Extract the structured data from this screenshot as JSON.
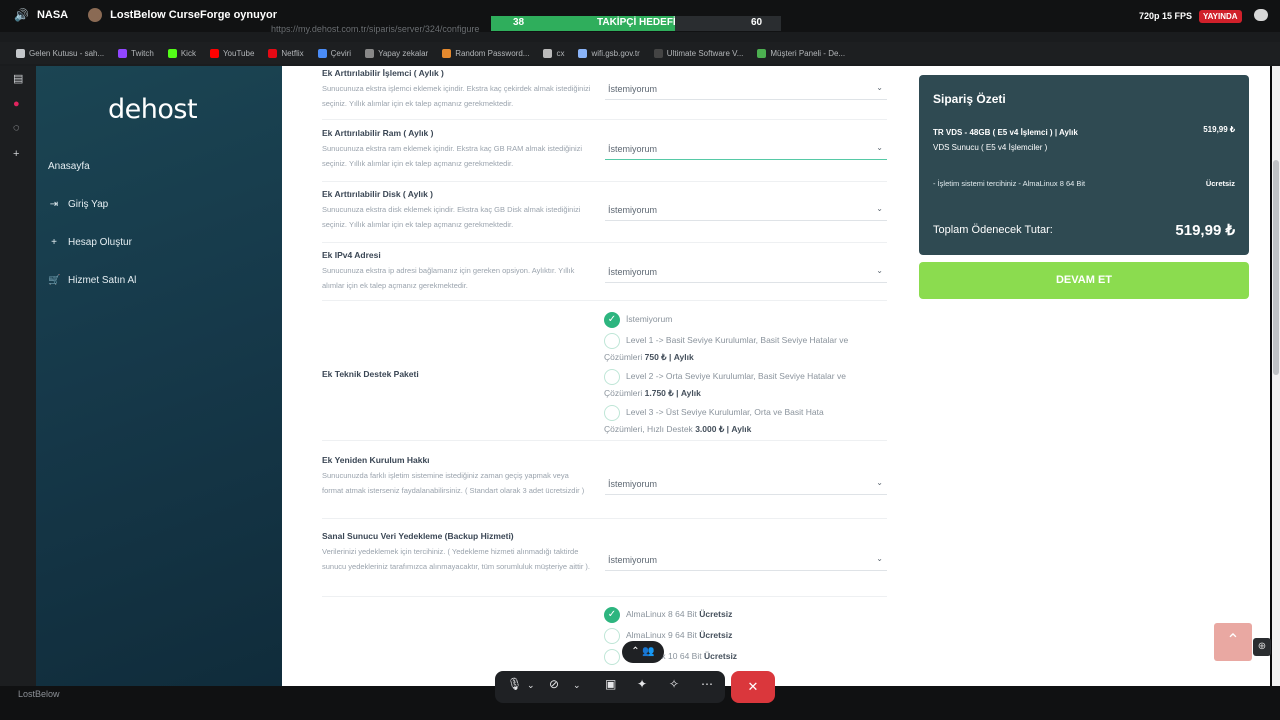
{
  "stream": {
    "channel": "NASA",
    "activity": "LostBelow CurseForge oynuyor",
    "goal_current": "38",
    "goal_label": "TAKİPÇİ HEDEFİ",
    "goal_target": "60",
    "goal_progress": 0.633,
    "quality": "720p 15 FPS",
    "live_badge": "YAYINDA"
  },
  "browser": {
    "url": "https://my.dehost.com.tr/siparis/server/324/configure",
    "bookmarks": [
      "Gelen Kutusu - sah...",
      "Twitch",
      "Kick",
      "YouTube",
      "Netflix",
      "Çeviri",
      "Yapay zekalar",
      "Random Password...",
      "cx",
      "wifi.gsb.gov.tr",
      "Ultimate Software V...",
      "Müşteri Paneli - De..."
    ]
  },
  "sidebar": {
    "logo": "dehost",
    "items": [
      {
        "label": "Anasayfa",
        "icon": "home-icon"
      },
      {
        "label": "Giriş Yap",
        "icon": "login-icon"
      },
      {
        "label": "Hesap Oluştur",
        "icon": "plus-icon"
      },
      {
        "label": "Hizmet Satın Al",
        "icon": "cart-icon"
      }
    ]
  },
  "form": {
    "cpu": {
      "title": "Ek Arttırılabilir İşlemci ( Aylık )",
      "desc": "Sunucunuza ekstra işlemci eklemek içindir. Ekstra kaç çekirdek almak istediğinizi seçiniz. Yıllık alımlar için ek talep açmanız gerekmektedir.",
      "value": "İstemiyorum"
    },
    "ram": {
      "title": "Ek Arttırılabilir Ram ( Aylık )",
      "desc": "Sunucunuza ekstra ram eklemek içindir. Ekstra kaç GB RAM almak istediğinizi seçiniz. Yıllık alımlar için ek talep açmanız gerekmektedir.",
      "value": "İstemiyorum"
    },
    "disk": {
      "title": "Ek Arttırılabilir Disk ( Aylık )",
      "desc": "Sunucunuza ekstra disk eklemek içindir. Ekstra kaç GB Disk almak istediğinizi seçiniz. Yıllık alımlar için ek talep açmanız gerekmektedir.",
      "value": "İstemiyorum"
    },
    "ipv4": {
      "title": "Ek IPv4 Adresi",
      "desc": "Sunucunuza ekstra ip adresi bağlamanız için gereken opsiyon. Aylıktır. Yıllık alımlar için ek talep açmanız gerekmektedir.",
      "value": "İstemiyorum"
    },
    "support": {
      "title": "Ek Teknik Destek Paketi",
      "options": [
        {
          "text": "İstemiyorum",
          "price": "",
          "period": "",
          "selected": true
        },
        {
          "text": "Level 1 -> Basit Seviye Kurulumlar, Basit Seviye Hatalar ve Çözümleri",
          "price": "750 ₺",
          "period": "Aylık",
          "selected": false
        },
        {
          "text": "Level 2 -> Orta Seviye Kurulumlar, Basit Seviye Hatalar ve Çözümleri",
          "price": "1.750 ₺",
          "period": "Aylık",
          "selected": false
        },
        {
          "text": "Level 3 -> Üst Seviye Kurulumlar, Orta ve Basit Hata Çözümleri, Hızlı Destek",
          "price": "3.000 ₺",
          "period": "Aylık",
          "selected": false
        }
      ]
    },
    "reinstall": {
      "title": "Ek Yeniden Kurulum Hakkı",
      "desc": "Sunucunuzda farklı işletim sistemine istediğiniz zaman geçiş yapmak veya format atmak isterseniz faydalanabilirsiniz. ( Standart olarak 3 adet ücretsizdir )",
      "value": "İstemiyorum"
    },
    "backup": {
      "title": "Sanal Sunucu Veri Yedekleme (Backup Hizmeti)",
      "desc": "Verilerinizi yedeklemek için tercihiniz. ( Yedekleme hizmeti alınmadığı taktirde sunucu yedekleriniz tarafımızca alınmayacaktır, tüm sorumluluk müşteriye aittir ).",
      "value": "İstemiyorum"
    },
    "os": [
      {
        "text": "AlmaLinux 8 64 Bit",
        "tag": "Ücretsiz",
        "selected": true
      },
      {
        "text": "AlmaLinux 9 64 Bit",
        "tag": "Ücretsiz",
        "selected": false
      },
      {
        "text": "AlmaLinux 10 64 Bit",
        "tag": "Ücretsiz",
        "selected": false
      }
    ]
  },
  "summary": {
    "title": "Sipariş Özeti",
    "product": "TR VDS - 48GB ( E5 v4 İşlemci ) | Aylık",
    "product_sub": "VDS Sunucu ( E5 v4 İşlemciler )",
    "product_price": "519,99 ₺",
    "os_line": "- İşletim sistemi tercihiniz - AlmaLinux 8 64 Bit",
    "os_price": "Ücretsiz",
    "total_label": "Toplam Ödenecek Tutar:",
    "total_value": "519,99 ₺",
    "continue_label": "DEVAM ET"
  },
  "call": {
    "user": "LostBelow"
  }
}
